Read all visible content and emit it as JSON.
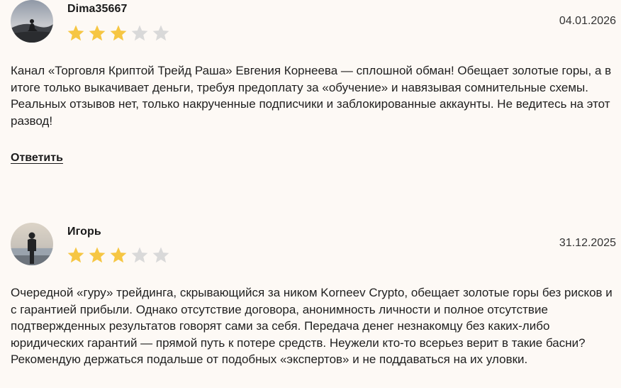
{
  "colors": {
    "background": "#fdf9f5",
    "star_filled": "#f6c643",
    "star_empty": "#d9d9d9",
    "text": "#1f1f1f"
  },
  "reviews": [
    {
      "author": "Dima35667",
      "date": "04.01.2026",
      "rating": 3,
      "max_rating": 5,
      "avatar_icon": "avatar-person-sitting-photo",
      "text": "Канал «Торговля Криптой Трейд Раша» Евгения Корнеева — сплошной обман! Обещает золотые горы, а в итоге только выкачивает деньги, требуя предоплату за «обучение» и навязывая сомнительные схемы. Реальных отзывов нет, только накрученные подписчики и заблокированные аккаунты. Не ведитесь на этот развод!",
      "reply_label": "Ответить"
    },
    {
      "author": "Игорь",
      "date": "31.12.2025",
      "rating": 3,
      "max_rating": 5,
      "avatar_icon": "avatar-person-standing-photo",
      "text": "Очередной «гуру» трейдинга, скрывающийся за ником Korneev Crypto, обещает золотые горы без рисков и с гарантией прибыли. Однако отсутствие договора, анонимность личности и полное отсутствие подтвержденных результатов говорят сами за себя. Передача денег незнакомцу без каких-либо юридических гарантий — прямой путь к потере средств. Неужели кто-то всерьез верит в такие басни? Рекомендую держаться подальше от подобных «экспертов» и не поддаваться на их уловки."
    }
  ]
}
